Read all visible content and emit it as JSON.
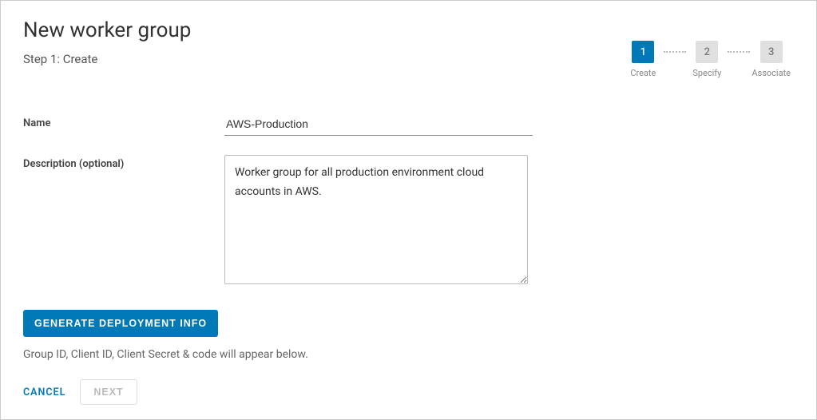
{
  "header": {
    "title": "New worker group",
    "step_label": "Step 1: Create"
  },
  "stepper": {
    "steps": [
      {
        "num": "1",
        "label": "Create",
        "active": true
      },
      {
        "num": "2",
        "label": "Specify",
        "active": false
      },
      {
        "num": "3",
        "label": "Associate",
        "active": false
      }
    ]
  },
  "form": {
    "name_label": "Name",
    "name_value": "AWS-Production",
    "desc_label": "Description (optional)",
    "desc_value": "Worker group for all production environment cloud accounts in AWS."
  },
  "actions": {
    "generate_label": "GENERATE DEPLOYMENT INFO",
    "hint": "Group ID, Client ID, Client Secret & code will appear below."
  },
  "footer": {
    "cancel_label": "CANCEL",
    "next_label": "NEXT"
  }
}
